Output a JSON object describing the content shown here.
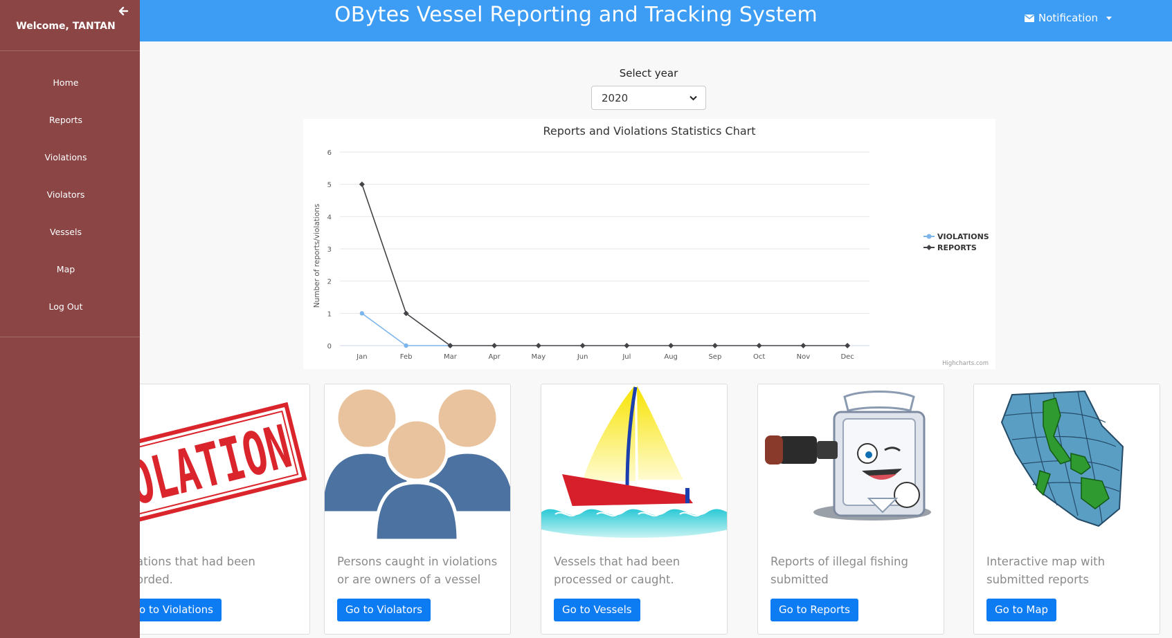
{
  "header": {
    "title": "OBytes Vessel Reporting and Tracking System",
    "notification_label": "Notification"
  },
  "sidebar": {
    "welcome": "Welcome, TANTAN",
    "items": [
      {
        "label": "Home"
      },
      {
        "label": "Reports"
      },
      {
        "label": "Violations"
      },
      {
        "label": "Violators"
      },
      {
        "label": "Vessels"
      },
      {
        "label": "Map"
      },
      {
        "label": "Log Out"
      }
    ]
  },
  "year_select": {
    "label": "Select year",
    "value": "2020"
  },
  "chart_data": {
    "type": "line",
    "title": "Reports and Violations Statistics Chart",
    "ylabel": "Number of reports/violations",
    "xlabel": "",
    "categories": [
      "Jan",
      "Feb",
      "Mar",
      "Apr",
      "May",
      "Jun",
      "Jul",
      "Aug",
      "Sep",
      "Oct",
      "Nov",
      "Dec"
    ],
    "ylim": [
      0,
      6
    ],
    "yticks": [
      0,
      1,
      2,
      3,
      4,
      5,
      6
    ],
    "grid": true,
    "legend_position": "right",
    "series": [
      {
        "name": "VIOLATIONS",
        "color": "#7cb5ec",
        "values": [
          1,
          0,
          0,
          null,
          null,
          null,
          null,
          null,
          null,
          null,
          null,
          null
        ]
      },
      {
        "name": "REPORTS",
        "color": "#434348",
        "values": [
          5,
          1,
          0,
          0,
          0,
          0,
          0,
          0,
          0,
          0,
          0,
          0
        ]
      }
    ],
    "credits": "Highcharts.com"
  },
  "cards": [
    {
      "image": "violation-stamp",
      "desc_line1": "ations that had been",
      "desc_line2": "orded.",
      "button": "o to Violations"
    },
    {
      "image": "people-group",
      "desc_line1": "Persons caught in violations",
      "desc_line2": "or are owners of a vessel",
      "button": "Go to Violators"
    },
    {
      "image": "sailboat",
      "desc_line1": "Vessels that had been",
      "desc_line2": "processed or caught.",
      "button": "Go to Vessels"
    },
    {
      "image": "binocular-mascot",
      "desc_line1": "Reports of illegal fishing",
      "desc_line2": "submitted",
      "button": "Go to Reports"
    },
    {
      "image": "philippines-map",
      "desc_line1": "Interactive map with",
      "desc_line2": "submitted reports",
      "button": "Go to Map"
    }
  ],
  "colors": {
    "header": "#3d9cf4",
    "sidebar": "#8b4545",
    "button": "#0d7bf1"
  }
}
